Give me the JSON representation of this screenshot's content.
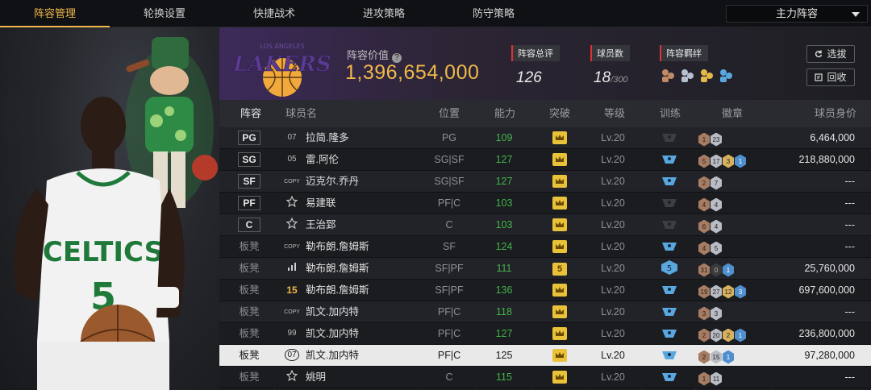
{
  "nav": {
    "tabs": [
      "阵容管理",
      "轮换设置",
      "快捷战术",
      "进攻策略",
      "防守策略"
    ],
    "active_tab": 0,
    "lineup_selector": "主力阵容"
  },
  "summary": {
    "value_label": "阵容价值",
    "value": "1,396,654,000",
    "rating_label": "阵容总评",
    "rating": "126",
    "players_label": "球员数",
    "players_count": "18",
    "players_max": "/300",
    "bonds_label": "阵容羁绊",
    "select_button": "选拔",
    "recycle_button": "回收",
    "team_logo_text": "LAKERS",
    "team_logo_subtext": "LOS ANGELES"
  },
  "table": {
    "headers": {
      "slot": "阵容",
      "name": "球员名",
      "position": "位置",
      "rating": "能力",
      "breakthrough": "突破",
      "level": "等级",
      "training": "训练",
      "badges": "徽章",
      "salary": "球员身价"
    },
    "rows": [
      {
        "slot": "PG",
        "bench": false,
        "card": "07",
        "name": "拉简.隆多",
        "position": "PG",
        "rating": "109",
        "break": "crown",
        "level": "Lv.20",
        "train": "dark",
        "badges": [
          [
            "1",
            "bronze"
          ],
          [
            "23",
            "silver"
          ]
        ],
        "salary": "6,464,000"
      },
      {
        "slot": "SG",
        "bench": false,
        "card": "05",
        "name": "雷.阿伦",
        "position": "SG|SF",
        "rating": "127",
        "break": "crown",
        "level": "Lv.20",
        "train": "blue",
        "badges": [
          [
            "5",
            "bronze"
          ],
          [
            "17",
            "silver"
          ],
          [
            "3",
            "gold"
          ],
          [
            "1",
            "blue"
          ]
        ],
        "salary": "218,880,000"
      },
      {
        "slot": "SF",
        "bench": false,
        "card": "COPY",
        "name": "迈克尔.乔丹",
        "position": "SG|SF",
        "rating": "127",
        "break": "crown",
        "level": "Lv.20",
        "train": "blue",
        "badges": [
          [
            "2",
            "bronze"
          ],
          [
            "7",
            "silver"
          ]
        ],
        "salary": "---"
      },
      {
        "slot": "PF",
        "bench": false,
        "card": "star",
        "name": "易建联",
        "position": "PF|C",
        "rating": "103",
        "break": "crown",
        "level": "Lv.20",
        "train": "dark",
        "badges": [
          [
            "4",
            "bronze"
          ],
          [
            "4",
            "silver"
          ]
        ],
        "salary": "---"
      },
      {
        "slot": "C",
        "bench": false,
        "card": "star",
        "name": "王治郅",
        "position": "C",
        "rating": "103",
        "break": "crown",
        "level": "Lv.20",
        "train": "dark",
        "badges": [
          [
            "6",
            "bronze"
          ],
          [
            "4",
            "silver"
          ]
        ],
        "salary": "---"
      },
      {
        "slot": "板凳",
        "bench": true,
        "card": "COPY",
        "name": "勒布朗.詹姆斯",
        "position": "SF",
        "rating": "124",
        "break": "crown",
        "level": "Lv.20",
        "train": "blue",
        "badges": [
          [
            "4",
            "bronze"
          ],
          [
            "5",
            "silver"
          ]
        ],
        "salary": "---"
      },
      {
        "slot": "板凳",
        "bench": true,
        "card": "bars",
        "name": "勒布朗.詹姆斯",
        "position": "SF|PF",
        "rating": "111",
        "break": "5",
        "level": "Lv.20",
        "train": "blue5",
        "badges": [
          [
            "31",
            "bronze"
          ],
          [
            "0",
            "dark"
          ],
          [
            "1",
            "blue"
          ]
        ],
        "salary": "25,760,000"
      },
      {
        "slot": "板凳",
        "bench": true,
        "card": "15",
        "name": "勒布朗.詹姆斯",
        "position": "SF|PF",
        "rating": "136",
        "break": "crown",
        "level": "Lv.20",
        "train": "blue",
        "badges": [
          [
            "19",
            "bronze"
          ],
          [
            "27",
            "silver"
          ],
          [
            "12",
            "gold"
          ],
          [
            "3",
            "blue"
          ]
        ],
        "salary": "697,600,000"
      },
      {
        "slot": "板凳",
        "bench": true,
        "card": "COPY",
        "name": "凯文.加内特",
        "position": "PF|C",
        "rating": "118",
        "break": "crown",
        "level": "Lv.20",
        "train": "blue",
        "badges": [
          [
            "3",
            "bronze"
          ],
          [
            "3",
            "silver"
          ]
        ],
        "salary": "---"
      },
      {
        "slot": "板凳",
        "bench": true,
        "card": "99",
        "name": "凯文.加内特",
        "position": "PF|C",
        "rating": "127",
        "break": "crown",
        "level": "Lv.20",
        "train": "blue",
        "badges": [
          [
            "2",
            "bronze"
          ],
          [
            "20",
            "silver"
          ],
          [
            "2",
            "gold"
          ],
          [
            "1",
            "blue"
          ]
        ],
        "salary": "236,800,000"
      },
      {
        "slot": "板凳",
        "bench": true,
        "selected": true,
        "card": "07",
        "name": "凯文.加内特",
        "position": "PF|C",
        "rating": "125",
        "break": "crown",
        "level": "Lv.20",
        "train": "blue",
        "badges": [
          [
            "2",
            "bronze"
          ],
          [
            "15",
            "silver"
          ],
          [
            "1",
            "blue"
          ]
        ],
        "salary": "97,280,000"
      },
      {
        "slot": "板凳",
        "bench": true,
        "card": "star",
        "name": "姚明",
        "position": "C",
        "rating": "115",
        "break": "crown",
        "level": "Lv.20",
        "train": "blue",
        "badges": [
          [
            "1",
            "bronze"
          ],
          [
            "11",
            "silver"
          ]
        ],
        "salary": "---"
      }
    ]
  },
  "colors": {
    "accent": "#f0b84a",
    "rating_green": "#43b34b",
    "badge_blue": "#4f8fce"
  }
}
